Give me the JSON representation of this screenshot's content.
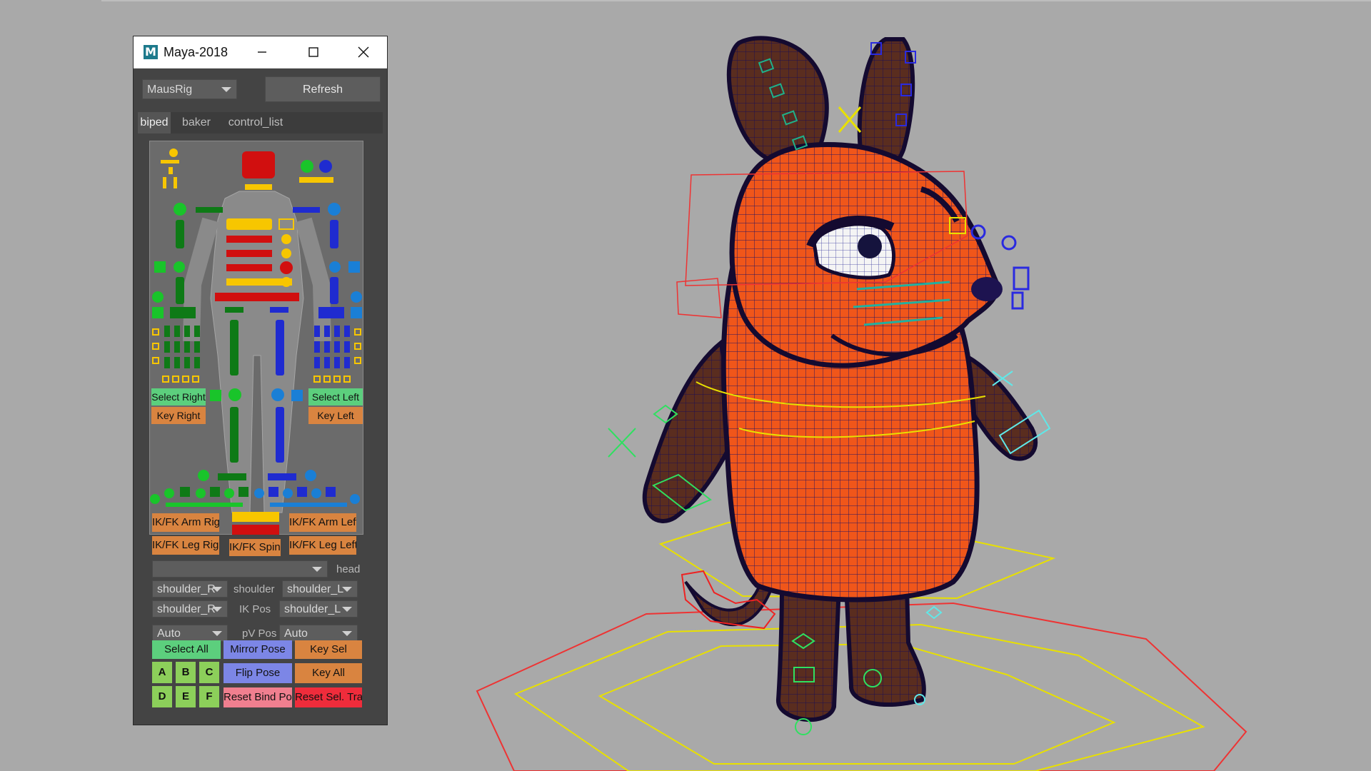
{
  "window": {
    "app_icon": "M",
    "title": "Maya-2018",
    "controls": [
      "minimize-icon",
      "maximize-icon",
      "close-icon"
    ]
  },
  "rig_select": {
    "value": "MausRig"
  },
  "refresh_label": "Refresh",
  "tabs": [
    {
      "label": "biped",
      "active": true
    },
    {
      "label": "baker",
      "active": false
    },
    {
      "label": "control_list",
      "active": false
    }
  ],
  "picker": {
    "select_right": "Select Right",
    "select_left": "Select Left",
    "key_right": "Key Right",
    "key_left": "Key Left"
  },
  "ikfk": {
    "arm_right": "IK/FK Arm Right",
    "arm_left": "IK/FK Arm Left",
    "leg_right": "IK/FK Leg Right",
    "leg_left": "IK/FK Leg Left",
    "spine": "IK/FK Spine"
  },
  "space": {
    "head_combo": "",
    "head_label": "head",
    "shoulder_r_combo": "shoulder_R",
    "shoulder_label": "shoulder",
    "shoulder_l_combo": "shoulder_L",
    "shoulder_r2_combo": "shoulder_R",
    "ik_pos_label": "IK Pos",
    "shoulder_l2_combo": "shoulder_L",
    "auto_r": "Auto",
    "pv_label": "pV Pos",
    "auto_l": "Auto"
  },
  "actions": {
    "select_all": "Select All",
    "mirror_pose": "Mirror Pose",
    "key_sel": "Key Sel",
    "a": "A",
    "b": "B",
    "c": "C",
    "flip_pose": "Flip Pose",
    "key_all": "Key All",
    "d": "D",
    "e": "E",
    "f": "F",
    "reset_bind_pose": "Reset Bind Pose",
    "reset_sel_trans": "Reset Sel. Trans"
  },
  "colors": {
    "viewport_bg": "#a9a9a9",
    "mouse_orange": "#f0561a",
    "mouse_brown": "#5a2d1f",
    "ctrl_green": "#19c42a",
    "ctrl_blue": "#1f2bd0",
    "ctrl_yellow": "#f7c600",
    "ctrl_red": "#d10f0f"
  }
}
